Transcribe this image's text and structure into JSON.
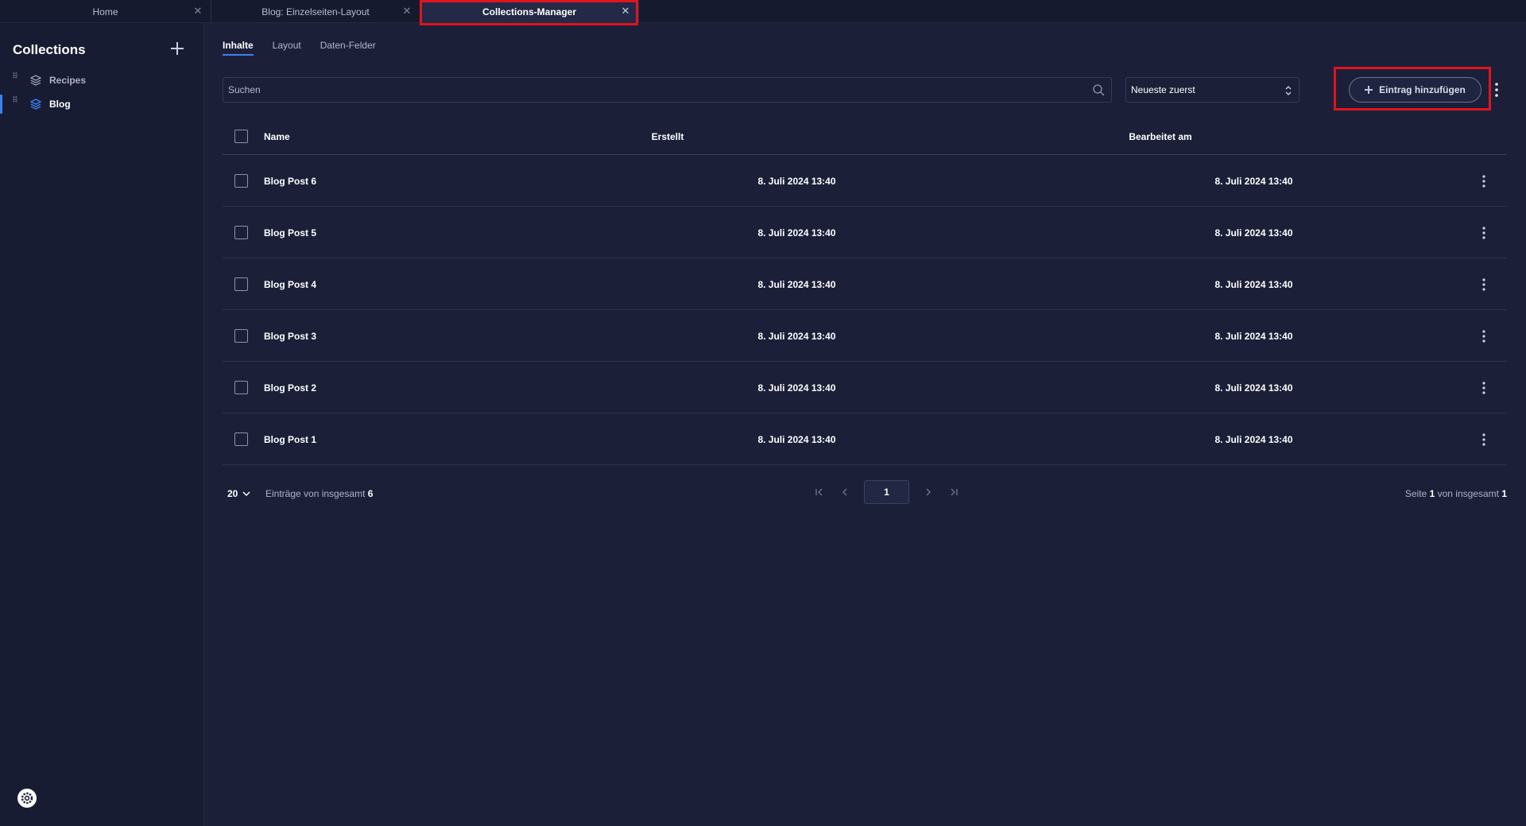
{
  "tabs": [
    {
      "label": "Home"
    },
    {
      "label": "Blog: Einzelseiten-Layout"
    },
    {
      "label": "Collections-Manager"
    }
  ],
  "sidebar": {
    "title": "Collections",
    "items": [
      {
        "label": "Recipes",
        "icon": "stack-icon"
      },
      {
        "label": "Blog",
        "icon": "stack-icon",
        "active": true
      }
    ]
  },
  "main": {
    "subtabs": [
      {
        "label": "Inhalte",
        "active": true
      },
      {
        "label": "Layout"
      },
      {
        "label": "Daten-Felder"
      }
    ],
    "search": {
      "placeholder": "Suchen"
    },
    "sort": {
      "value": "Neueste zuerst"
    },
    "add_button": {
      "label": "Eintrag hinzufügen"
    }
  },
  "table": {
    "headers": {
      "name": "Name",
      "created": "Erstellt",
      "edited": "Bearbeitet am"
    },
    "rows": [
      {
        "name": "Blog Post 6",
        "created": "8. Juli 2024 13:40",
        "edited": "8. Juli 2024 13:40"
      },
      {
        "name": "Blog Post 5",
        "created": "8. Juli 2024 13:40",
        "edited": "8. Juli 2024 13:40"
      },
      {
        "name": "Blog Post 4",
        "created": "8. Juli 2024 13:40",
        "edited": "8. Juli 2024 13:40"
      },
      {
        "name": "Blog Post 3",
        "created": "8. Juli 2024 13:40",
        "edited": "8. Juli 2024 13:40"
      },
      {
        "name": "Blog Post 2",
        "created": "8. Juli 2024 13:40",
        "edited": "8. Juli 2024 13:40"
      },
      {
        "name": "Blog Post 1",
        "created": "8. Juli 2024 13:40",
        "edited": "8. Juli 2024 13:40"
      }
    ]
  },
  "footer": {
    "page_size": "20",
    "count_prefix": "Einträge von insgesamt",
    "count_total": "6",
    "current_page": "1",
    "page_prefix": "Seite",
    "page_current": "1",
    "page_mid": "von insgesamt",
    "page_total": "1"
  },
  "colors": {
    "background": "#1b2038",
    "sidebar": "#181c32",
    "accent": "#3f7ef6",
    "highlight": "#e0141e"
  }
}
